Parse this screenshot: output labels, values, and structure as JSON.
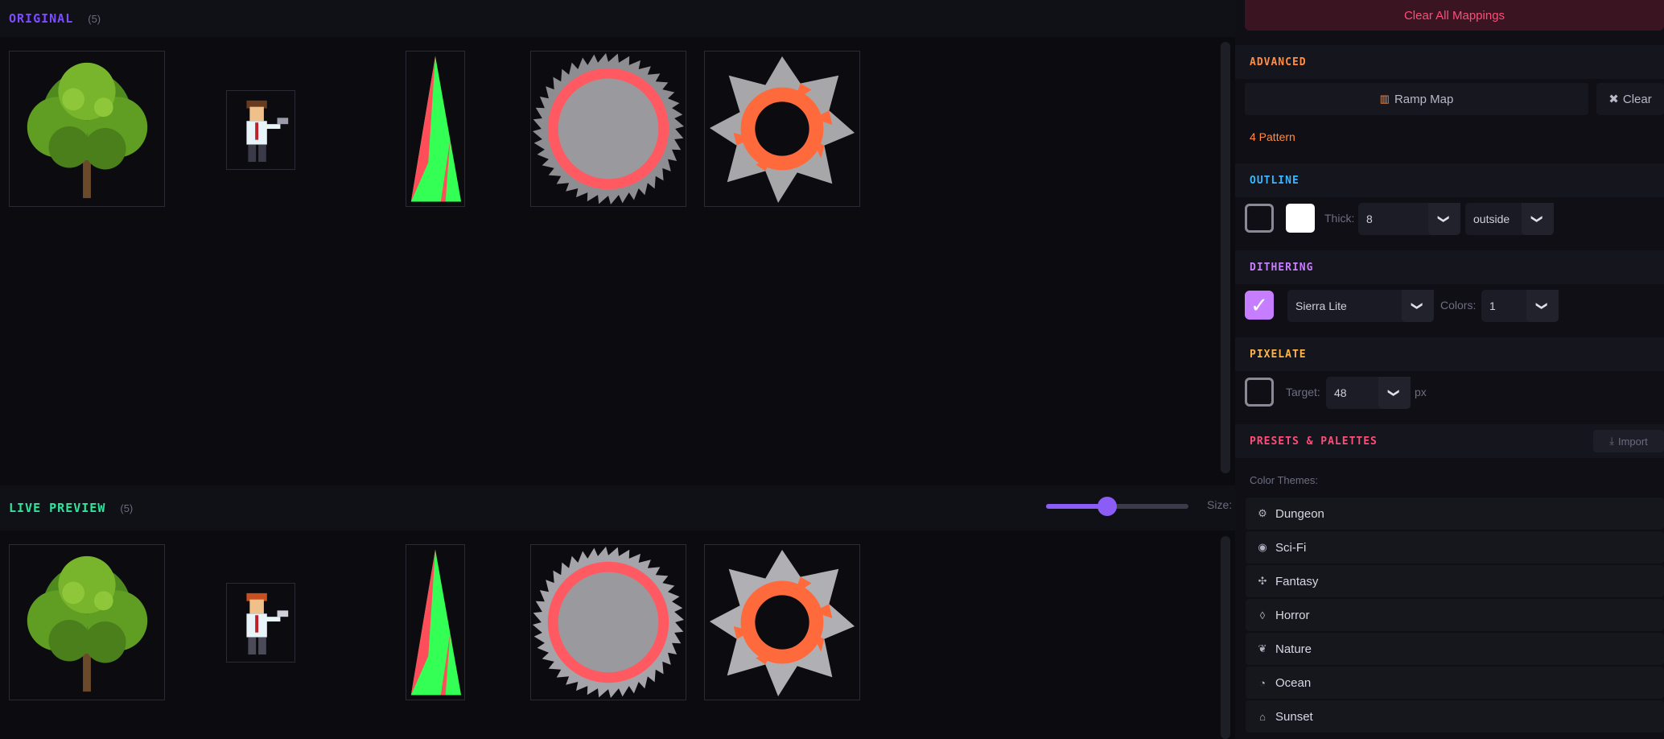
{
  "original": {
    "title": "ORIGINAL",
    "count": "(5)"
  },
  "preview": {
    "title": "LIVE PREVIEW",
    "count": "(5)",
    "size_label": "Size:",
    "size_value": 0.42
  },
  "panel": {
    "clear_all": "Clear All Mappings",
    "advanced": {
      "title": "ADVANCED",
      "ramp_map": "Ramp Map",
      "clear": "Clear",
      "pattern_text": "4 Pattern"
    },
    "outline": {
      "title": "OUTLINE",
      "thick_label": "Thick:",
      "thick_value": "8",
      "position_value": "outside",
      "enabled": false,
      "color": "#ffffff"
    },
    "dithering": {
      "title": "DITHERING",
      "enabled": true,
      "method": "Sierra Lite",
      "colors_label": "Colors:",
      "colors_value": "1"
    },
    "pixelate": {
      "title": "PIXELATE",
      "enabled": false,
      "target_label": "Target:",
      "target_value": "48",
      "unit": "px"
    },
    "presets": {
      "title": "PRESETS & PALETTES",
      "import": "Import",
      "themes_label": "Color Themes:",
      "themes": [
        {
          "label": "Dungeon",
          "icon": "dungeon-icon"
        },
        {
          "label": "Sci-Fi",
          "icon": "scifi-icon"
        },
        {
          "label": "Fantasy",
          "icon": "fantasy-icon"
        },
        {
          "label": "Horror",
          "icon": "horror-icon"
        },
        {
          "label": "Nature",
          "icon": "nature-icon"
        },
        {
          "label": "Ocean",
          "icon": "ocean-icon"
        },
        {
          "label": "Sunset",
          "icon": "sunset-icon"
        }
      ]
    }
  },
  "colors": {
    "accent": "#8b5cf6",
    "original_title": "#7c4dff",
    "preview_title": "#2ee59d",
    "advanced": "#ff8c42",
    "outline": "#38b6ff",
    "dithering": "#c77dff",
    "pixelate": "#ffb347",
    "presets": "#ff4d7a",
    "danger": "#ff4d7a"
  }
}
